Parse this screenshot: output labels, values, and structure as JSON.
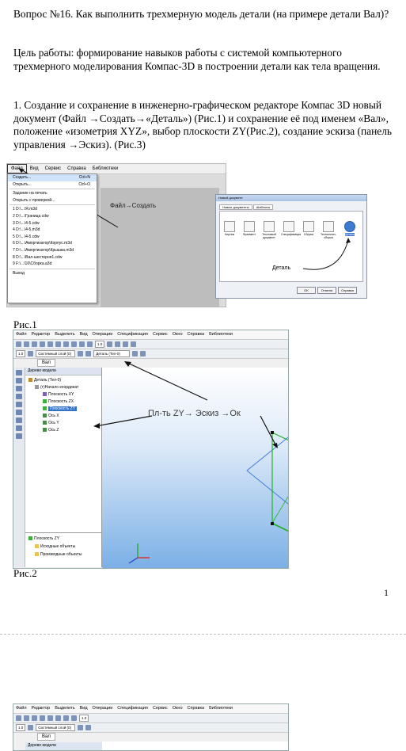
{
  "intro": {
    "title": "Вопрос №16. Как выполнить трехмерную модель детали (на примере детали Вал)?",
    "aim": "Цель работы: формирование навыков работы с системой компьютерного трехмерного моделирования Компас-3D в построении детали как тела вращения.",
    "step1": "1. Создание и сохранение в инженерно-графическом редакторе Компас 3D новый документ (Файл →Создать→«Деталь») (Рис.1) и сохранение её под именем «Вал», положение «изометрия XYZ», выбор плоскости ZY(Рис.2), создание эскиза (панель управления →Эскиз). (Рис.3)"
  },
  "figure1": {
    "menubar": [
      "Файл",
      "Вид",
      "Сервис",
      "Справка",
      "Библиотеки"
    ],
    "menu_items": [
      {
        "label": "Создать...",
        "shortcut": "Ctrl+N",
        "selected": true
      },
      {
        "label": "Открыть...",
        "shortcut": "Ctrl+O"
      },
      {
        "label": "Задание на печать",
        "shortcut": ""
      },
      {
        "label": "Открыть с проверкой...",
        "shortcut": ""
      },
      {
        "label": "1 D:\\...\\Я.m3d",
        "shortcut": ""
      },
      {
        "label": "2 D:\\...\\Граница.cdw",
        "shortcut": ""
      },
      {
        "label": "3 D:\\...\\4-5.cdw",
        "shortcut": ""
      },
      {
        "label": "4 D:\\...\\4-5.m3d",
        "shortcut": ""
      },
      {
        "label": "5 D:\\...\\4-5.cdw",
        "shortcut": ""
      },
      {
        "label": "6 D:\\...\\Амортизатор\\Корпус.m3d",
        "shortcut": ""
      },
      {
        "label": "7 D:\\...\\Амортизатор\\Крышка.m3d",
        "shortcut": ""
      },
      {
        "label": "8 D:\\...\\Вал-шестерня1.cdw",
        "shortcut": ""
      },
      {
        "label": "9 F:\\...\\16\\Сборка.a3d",
        "shortcut": ""
      },
      {
        "label": "Выход",
        "shortcut": ""
      }
    ],
    "annotation_create": "Файл→Создать",
    "dialog": {
      "title": "Новый документ",
      "tabs": [
        "Новые документы",
        "Шаблоны"
      ],
      "icons": [
        "Чертеж",
        "Фрагмент",
        "Текстовый документ",
        "Спецификация",
        "Сборка",
        "Технологич. сборка",
        "Деталь"
      ],
      "annotation_detail": "Деталь",
      "buttons": [
        "OK",
        "Отмена",
        "Справка"
      ]
    }
  },
  "caption1": "Рис.1",
  "figure2": {
    "menubar": [
      "Файл",
      "Редактор",
      "Выделить",
      "Вид",
      "Операции",
      "Спецификация",
      "Сервис",
      "Окно",
      "Справка",
      "Библиотеки"
    ],
    "scale_value": "1.0",
    "layer_value": "Системный слой (0)",
    "detail_value": "Деталь (Тел-0)",
    "doc_tab": "Вал",
    "tree_header": "Дерево модели",
    "tree": [
      {
        "label": "Деталь (Тел-0)",
        "color": "#c08a2e"
      },
      {
        "label": "(т)Начало координат",
        "color": "#999999"
      },
      {
        "label": "Плоскость XY",
        "color": "#7b5fb8"
      },
      {
        "label": "Плоскость ZX",
        "color": "#3fae3f"
      },
      {
        "label": "Плоскость ZY",
        "color": "#3fae3f",
        "selected": true
      },
      {
        "label": "Ось X",
        "color": "#4a8a4a"
      },
      {
        "label": "Ось Y",
        "color": "#4a8a4a"
      },
      {
        "label": "Ось Z",
        "color": "#4a8a4a"
      }
    ],
    "lower_tree": [
      {
        "label": "Плоскость ZY",
        "color": "#3fae3f"
      },
      {
        "label": "Исходные объекты",
        "color": "#e8c454"
      },
      {
        "label": "Производные объекты",
        "color": "#e8c454"
      }
    ],
    "annotation": "Пл-ть ZY→ Эскиз  →Ок"
  },
  "caption2": "Рис.2",
  "page_number": "1",
  "figure3": {
    "menubar": [
      "Файл",
      "Редактор",
      "Выделить",
      "Вид",
      "Операции",
      "Спецификация",
      "Сервис",
      "Окно",
      "Справка",
      "Библиотеки"
    ],
    "scale_value": "1.0",
    "layer_value": "Системный слой (0)",
    "doc_tab": "Вал",
    "tree_header": "Дерево модели"
  }
}
